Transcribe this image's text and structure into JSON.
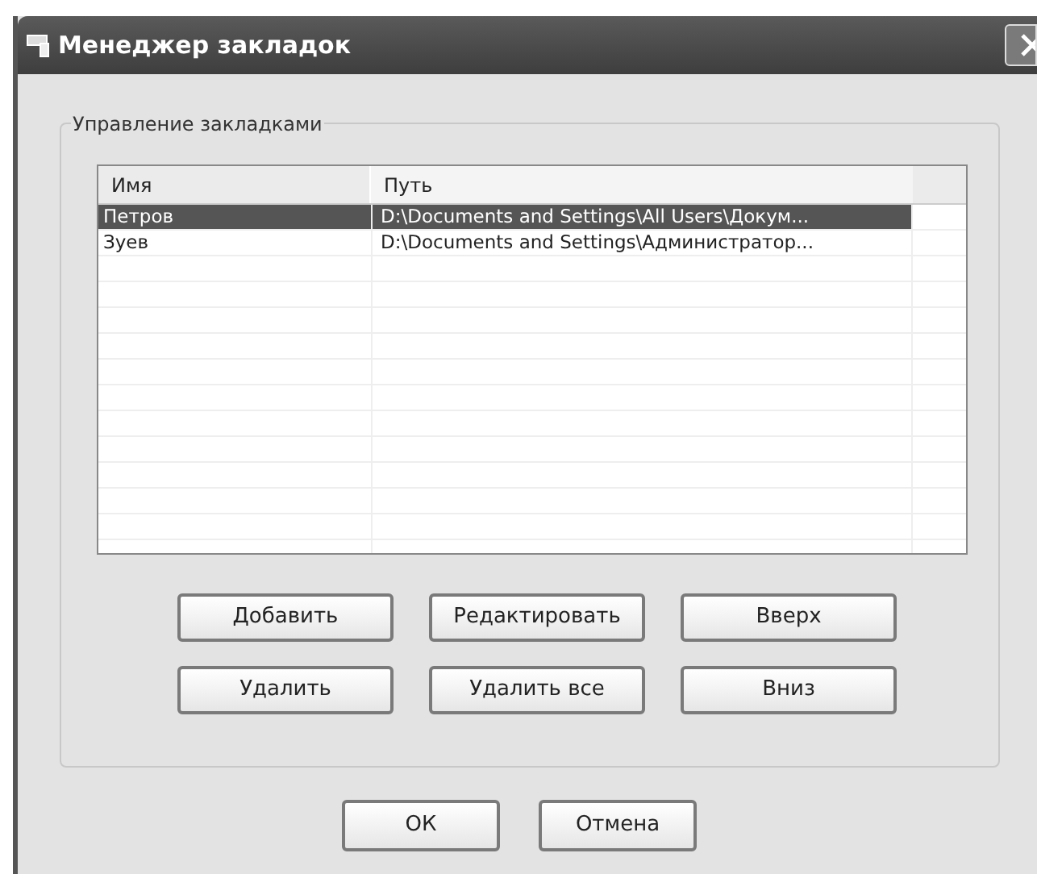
{
  "window": {
    "title": "Менеджер закладок"
  },
  "group": {
    "title": "Управление закладками"
  },
  "table": {
    "columns": [
      "Имя",
      "Путь"
    ],
    "rows": [
      {
        "name": "Петров",
        "path": "D:\\Documents and Settings\\All Users\\Докум...",
        "selected": true
      },
      {
        "name": "Зуев",
        "path": "D:\\Documents and Settings\\Администратор...",
        "selected": false
      }
    ]
  },
  "buttons": [
    [
      "Добавить",
      "Редактировать",
      "Вверх"
    ],
    [
      "Удалить",
      "Удалить все",
      "Вниз"
    ]
  ],
  "dialog_buttons": [
    "ОК",
    "Отмена"
  ]
}
